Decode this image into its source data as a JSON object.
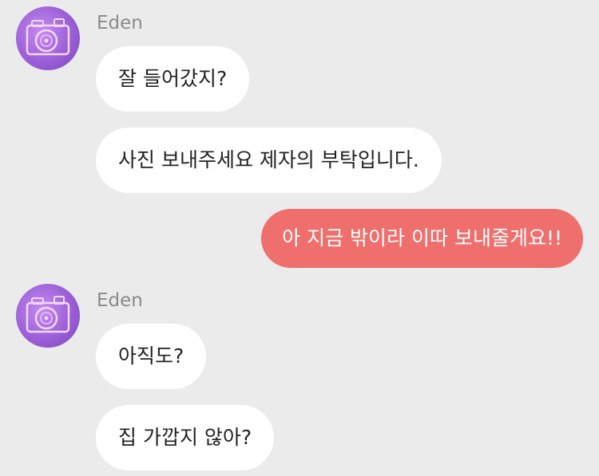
{
  "colors": {
    "background": "#ebebeb",
    "incoming_bubble": "#ffffff",
    "outgoing_bubble": "#ef6f6c",
    "sender_name": "#8a8a8a",
    "avatar": "#9b5fd6"
  },
  "groups": [
    {
      "sender": "Eden",
      "avatar_icon": "camera-icon",
      "messages": [
        "잘 들어갔지?",
        "사진 보내주세요 제자의 부탁입니다."
      ]
    },
    {
      "outgoing": true,
      "messages": [
        "아 지금 밖이라 이따 보내줄게요!!"
      ]
    },
    {
      "sender": "Eden",
      "avatar_icon": "camera-icon",
      "messages": [
        "아직도?",
        "집 가깝지 않아?"
      ]
    }
  ]
}
